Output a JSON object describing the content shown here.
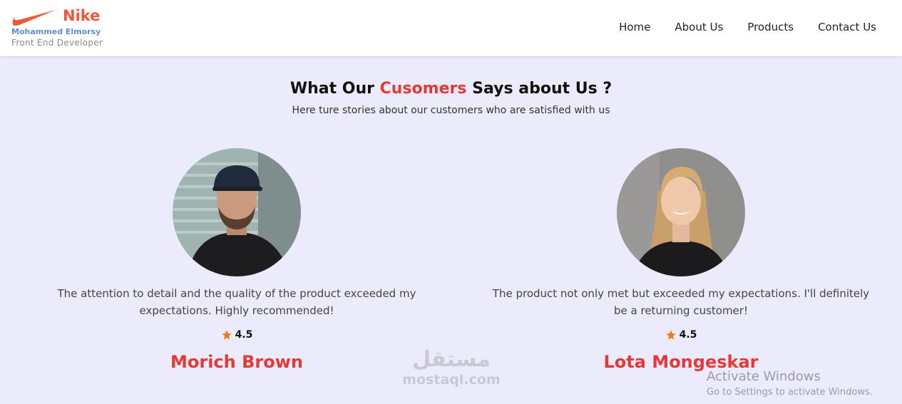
{
  "brand": {
    "name": "Nike",
    "person": "Mohammed Elmorsy",
    "role": "Front End Developer",
    "accent_color": "#f0573c"
  },
  "nav": {
    "items": [
      {
        "label": "Home"
      },
      {
        "label": "About Us"
      },
      {
        "label": "Products"
      },
      {
        "label": "Contact Us"
      }
    ]
  },
  "section": {
    "title_before": "What Our ",
    "title_accent": "Cusomers",
    "title_after": " Says about Us ?",
    "subtitle": "Here ture stories about our customers who are satisfied with us",
    "accent_color": "#e53935"
  },
  "testimonials": [
    {
      "quote": "The attention to detail and the quality of the product exceeded my expectations. Highly recommended!",
      "rating": "4.5",
      "name": "Morich Brown"
    },
    {
      "quote": "The product not only met but exceeded my expectations. I'll definitely be a returning customer!",
      "rating": "4.5",
      "name": "Lota Mongeskar"
    }
  ],
  "watermark": {
    "arabic": "مستقل",
    "domain": "mostaql.com"
  },
  "os_overlay": {
    "title": "Activate Windows",
    "message": "Go to Settings to activate Windows."
  }
}
